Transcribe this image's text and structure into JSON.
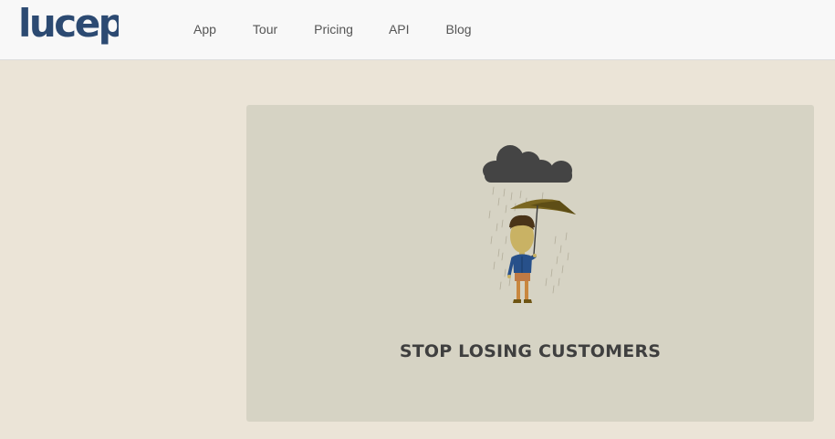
{
  "brand": {
    "logo_text": "lucep",
    "color": "#2c4a72"
  },
  "nav": {
    "items": [
      {
        "label": "App"
      },
      {
        "label": "Tour"
      },
      {
        "label": "Pricing"
      },
      {
        "label": "API"
      },
      {
        "label": "Blog"
      }
    ]
  },
  "hero": {
    "heading": "STOP LOSING CUSTOMERS",
    "illustration": "rain-cloud-person-umbrella"
  },
  "colors": {
    "page_background": "#ebe4d7",
    "header_background": "#f8f8f8",
    "hero_background": "#d6d3c4",
    "heading_text": "#3f3f3f",
    "nav_text": "#555555"
  }
}
